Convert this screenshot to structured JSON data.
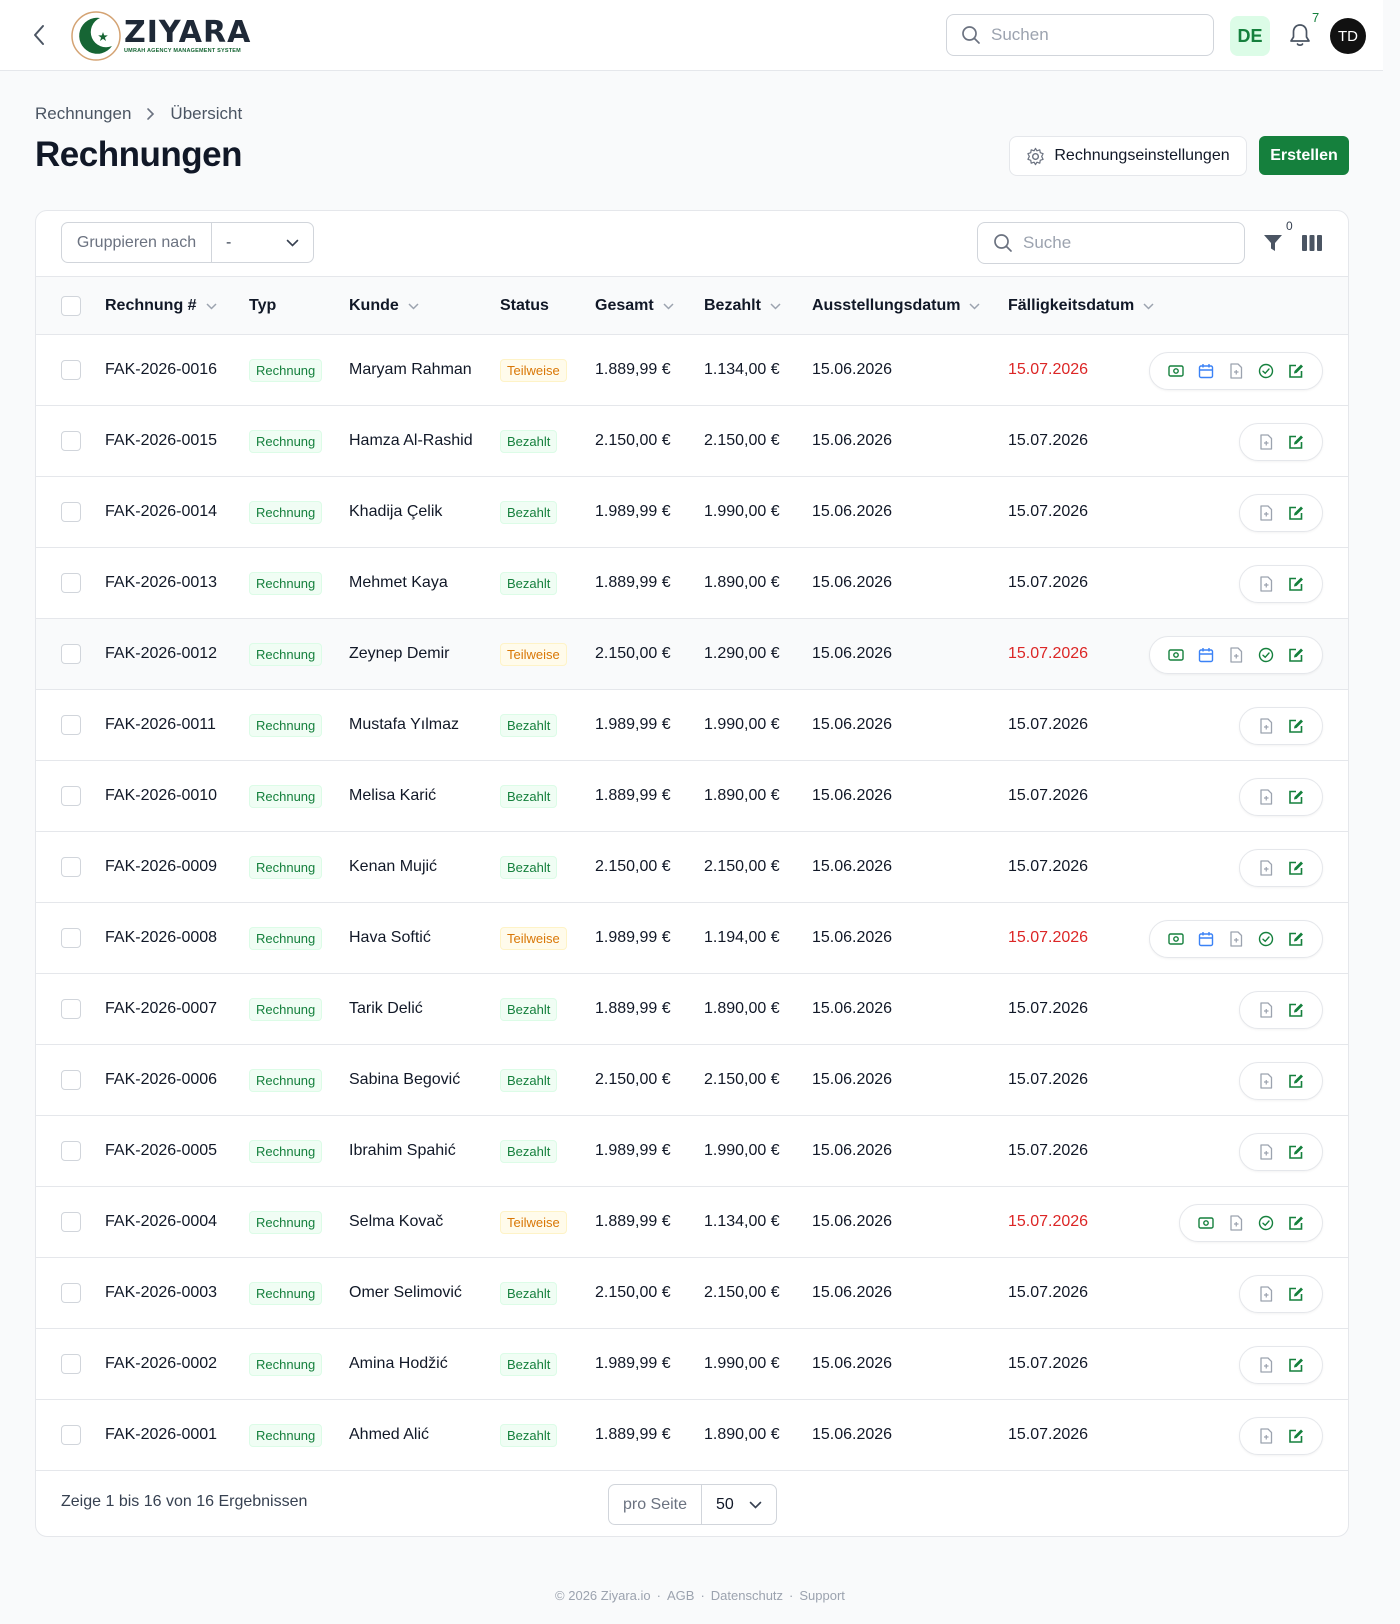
{
  "topbar": {
    "logo_name": "ZIYARA",
    "logo_tagline": "UMRAH AGENCY MANAGEMENT SYSTEM",
    "search_placeholder": "Suchen",
    "language": "DE",
    "notification_count": "7",
    "avatar_initials": "TD"
  },
  "breadcrumb": [
    "Rechnungen",
    "Übersicht"
  ],
  "page_title": "Rechnungen",
  "buttons": {
    "settings": "Rechnungseinstellungen",
    "create": "Erstellen"
  },
  "toolbar": {
    "group_by_label": "Gruppieren nach",
    "group_by_value": "-",
    "search_placeholder": "Suche",
    "filter_count": "0"
  },
  "columns": {
    "invoice": "Rechnung #",
    "type": "Typ",
    "customer": "Kunde",
    "status": "Status",
    "total": "Gesamt",
    "paid": "Bezahlt",
    "issue_date": "Ausstellungsdatum",
    "due_date": "Fälligkeitsdatum"
  },
  "rows": [
    {
      "id": "FAK-2026-0016",
      "type": "Rechnung",
      "customer": "Maryam Rahman",
      "status": "Teilweise",
      "total": "1.889,99 €",
      "paid": "1.134,00 €",
      "issued": "15.06.2026",
      "due": "15.07.2026",
      "overdue": true,
      "actions": [
        "money-icon",
        "calendar-icon",
        "document-icon",
        "check-circle-icon",
        "edit-icon"
      ]
    },
    {
      "id": "FAK-2026-0015",
      "type": "Rechnung",
      "customer": "Hamza Al-Rashid",
      "status": "Bezahlt",
      "total": "2.150,00 €",
      "paid": "2.150,00 €",
      "issued": "15.06.2026",
      "due": "15.07.2026",
      "overdue": false,
      "actions": [
        "document-icon",
        "edit-icon"
      ]
    },
    {
      "id": "FAK-2026-0014",
      "type": "Rechnung",
      "customer": "Khadija Çelik",
      "status": "Bezahlt",
      "total": "1.989,99 €",
      "paid": "1.990,00 €",
      "issued": "15.06.2026",
      "due": "15.07.2026",
      "overdue": false,
      "actions": [
        "document-icon",
        "edit-icon"
      ]
    },
    {
      "id": "FAK-2026-0013",
      "type": "Rechnung",
      "customer": "Mehmet Kaya",
      "status": "Bezahlt",
      "total": "1.889,99 €",
      "paid": "1.890,00 €",
      "issued": "15.06.2026",
      "due": "15.07.2026",
      "overdue": false,
      "actions": [
        "document-icon",
        "edit-icon"
      ]
    },
    {
      "id": "FAK-2026-0012",
      "type": "Rechnung",
      "customer": "Zeynep Demir",
      "status": "Teilweise",
      "total": "2.150,00 €",
      "paid": "1.290,00 €",
      "issued": "15.06.2026",
      "due": "15.07.2026",
      "overdue": true,
      "actions": [
        "money-icon",
        "calendar-icon",
        "document-icon",
        "check-circle-icon",
        "edit-icon"
      ]
    },
    {
      "id": "FAK-2026-0011",
      "type": "Rechnung",
      "customer": "Mustafa Yılmaz",
      "status": "Bezahlt",
      "total": "1.989,99 €",
      "paid": "1.990,00 €",
      "issued": "15.06.2026",
      "due": "15.07.2026",
      "overdue": false,
      "actions": [
        "document-icon",
        "edit-icon"
      ]
    },
    {
      "id": "FAK-2026-0010",
      "type": "Rechnung",
      "customer": "Melisa Karić",
      "status": "Bezahlt",
      "total": "1.889,99 €",
      "paid": "1.890,00 €",
      "issued": "15.06.2026",
      "due": "15.07.2026",
      "overdue": false,
      "actions": [
        "document-icon",
        "edit-icon"
      ]
    },
    {
      "id": "FAK-2026-0009",
      "type": "Rechnung",
      "customer": "Kenan Mujić",
      "status": "Bezahlt",
      "total": "2.150,00 €",
      "paid": "2.150,00 €",
      "issued": "15.06.2026",
      "due": "15.07.2026",
      "overdue": false,
      "actions": [
        "document-icon",
        "edit-icon"
      ]
    },
    {
      "id": "FAK-2026-0008",
      "type": "Rechnung",
      "customer": "Hava Softić",
      "status": "Teilweise",
      "total": "1.989,99 €",
      "paid": "1.194,00 €",
      "issued": "15.06.2026",
      "due": "15.07.2026",
      "overdue": true,
      "actions": [
        "money-icon",
        "calendar-icon",
        "document-icon",
        "check-circle-icon",
        "edit-icon"
      ]
    },
    {
      "id": "FAK-2026-0007",
      "type": "Rechnung",
      "customer": "Tarik Delić",
      "status": "Bezahlt",
      "total": "1.889,99 €",
      "paid": "1.890,00 €",
      "issued": "15.06.2026",
      "due": "15.07.2026",
      "overdue": false,
      "actions": [
        "document-icon",
        "edit-icon"
      ]
    },
    {
      "id": "FAK-2026-0006",
      "type": "Rechnung",
      "customer": "Sabina Begović",
      "status": "Bezahlt",
      "total": "2.150,00 €",
      "paid": "2.150,00 €",
      "issued": "15.06.2026",
      "due": "15.07.2026",
      "overdue": false,
      "actions": [
        "document-icon",
        "edit-icon"
      ]
    },
    {
      "id": "FAK-2026-0005",
      "type": "Rechnung",
      "customer": "Ibrahim Spahić",
      "status": "Bezahlt",
      "total": "1.989,99 €",
      "paid": "1.990,00 €",
      "issued": "15.06.2026",
      "due": "15.07.2026",
      "overdue": false,
      "actions": [
        "document-icon",
        "edit-icon"
      ]
    },
    {
      "id": "FAK-2026-0004",
      "type": "Rechnung",
      "customer": "Selma Kovač",
      "status": "Teilweise",
      "total": "1.889,99 €",
      "paid": "1.134,00 €",
      "issued": "15.06.2026",
      "due": "15.07.2026",
      "overdue": true,
      "actions": [
        "money-icon",
        "document-icon",
        "check-circle-icon",
        "edit-icon"
      ]
    },
    {
      "id": "FAK-2026-0003",
      "type": "Rechnung",
      "customer": "Omer Selimović",
      "status": "Bezahlt",
      "total": "2.150,00 €",
      "paid": "2.150,00 €",
      "issued": "15.06.2026",
      "due": "15.07.2026",
      "overdue": false,
      "actions": [
        "document-icon",
        "edit-icon"
      ]
    },
    {
      "id": "FAK-2026-0002",
      "type": "Rechnung",
      "customer": "Amina Hodžić",
      "status": "Bezahlt",
      "total": "1.989,99 €",
      "paid": "1.990,00 €",
      "issued": "15.06.2026",
      "due": "15.07.2026",
      "overdue": false,
      "actions": [
        "document-icon",
        "edit-icon"
      ]
    },
    {
      "id": "FAK-2026-0001",
      "type": "Rechnung",
      "customer": "Ahmed Alić",
      "status": "Bezahlt",
      "total": "1.889,99 €",
      "paid": "1.890,00 €",
      "issued": "15.06.2026",
      "due": "15.07.2026",
      "overdue": false,
      "actions": [
        "document-icon",
        "edit-icon"
      ]
    }
  ],
  "highlighted_row": 4,
  "pagination": {
    "result_text": "Zeige 1 bis 16 von 16 Ergebnissen",
    "per_page_label": "pro Seite",
    "per_page_value": "50"
  },
  "footer": {
    "copyright": "© 2026 Ziyara.io",
    "links": [
      "AGB",
      "Datenschutz",
      "Support"
    ]
  },
  "colors": {
    "brand": "#15803d",
    "overdue": "#dc2626",
    "partial": "#d97706",
    "calendar_icon": "#3b82f6"
  }
}
